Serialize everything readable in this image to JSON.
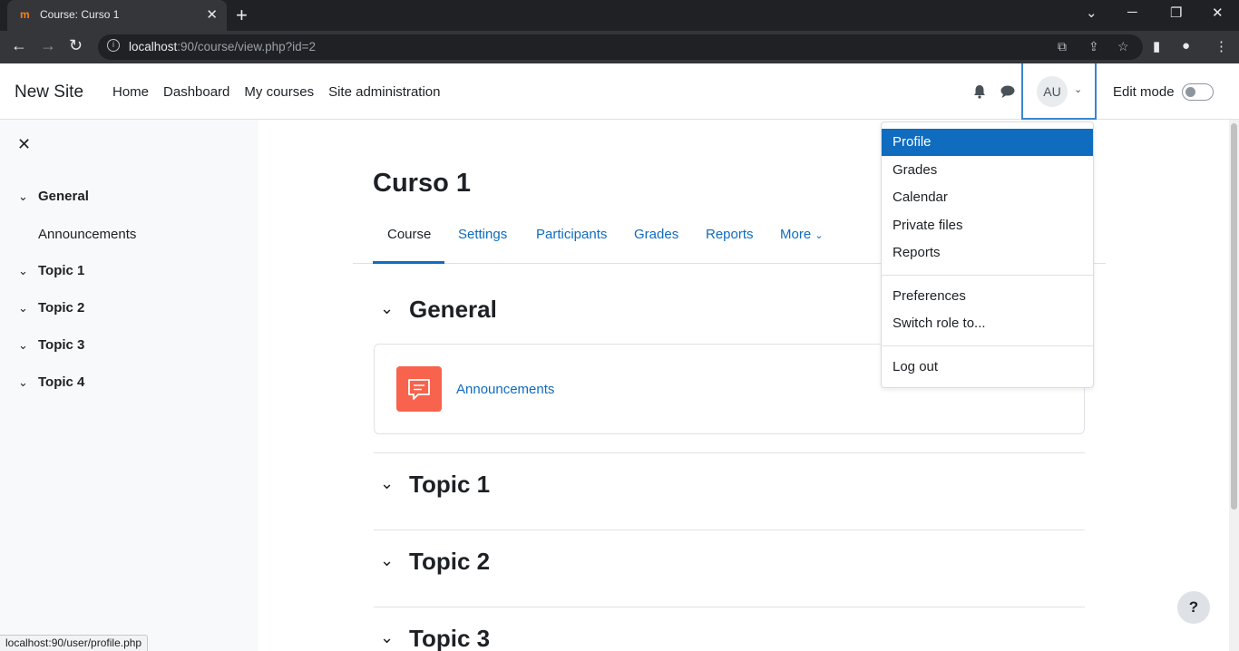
{
  "browser": {
    "tab_title": "Course: Curso 1",
    "favicon": "m",
    "url_host": "localhost",
    "url_rest": ":90/course/view.php?id=2"
  },
  "navbar": {
    "brand": "New Site",
    "links": [
      "Home",
      "Dashboard",
      "My courses",
      "Site administration"
    ],
    "avatar_initials": "AU",
    "edit_mode_label": "Edit mode"
  },
  "drawer": {
    "items": [
      {
        "label": "General"
      },
      {
        "label": "Announcements"
      },
      {
        "label": "Topic 1"
      },
      {
        "label": "Topic 2"
      },
      {
        "label": "Topic 3"
      },
      {
        "label": "Topic 4"
      }
    ]
  },
  "main": {
    "course_title": "Curso 1",
    "tabs": [
      "Course",
      "Settings",
      "Participants",
      "Grades",
      "Reports",
      "More"
    ],
    "sections": [
      "General",
      "Topic 1",
      "Topic 2",
      "Topic 3"
    ],
    "activity_label": "Announcements"
  },
  "dropdown": {
    "items": [
      "Profile",
      "Grades",
      "Calendar",
      "Private files",
      "Reports",
      "Preferences",
      "Switch role to...",
      "Log out"
    ]
  },
  "status_url": "localhost:90/user/profile.php",
  "help_label": "?",
  "colors": {
    "accent": "#0f6cbf",
    "forum_icon": "#f7634d"
  }
}
